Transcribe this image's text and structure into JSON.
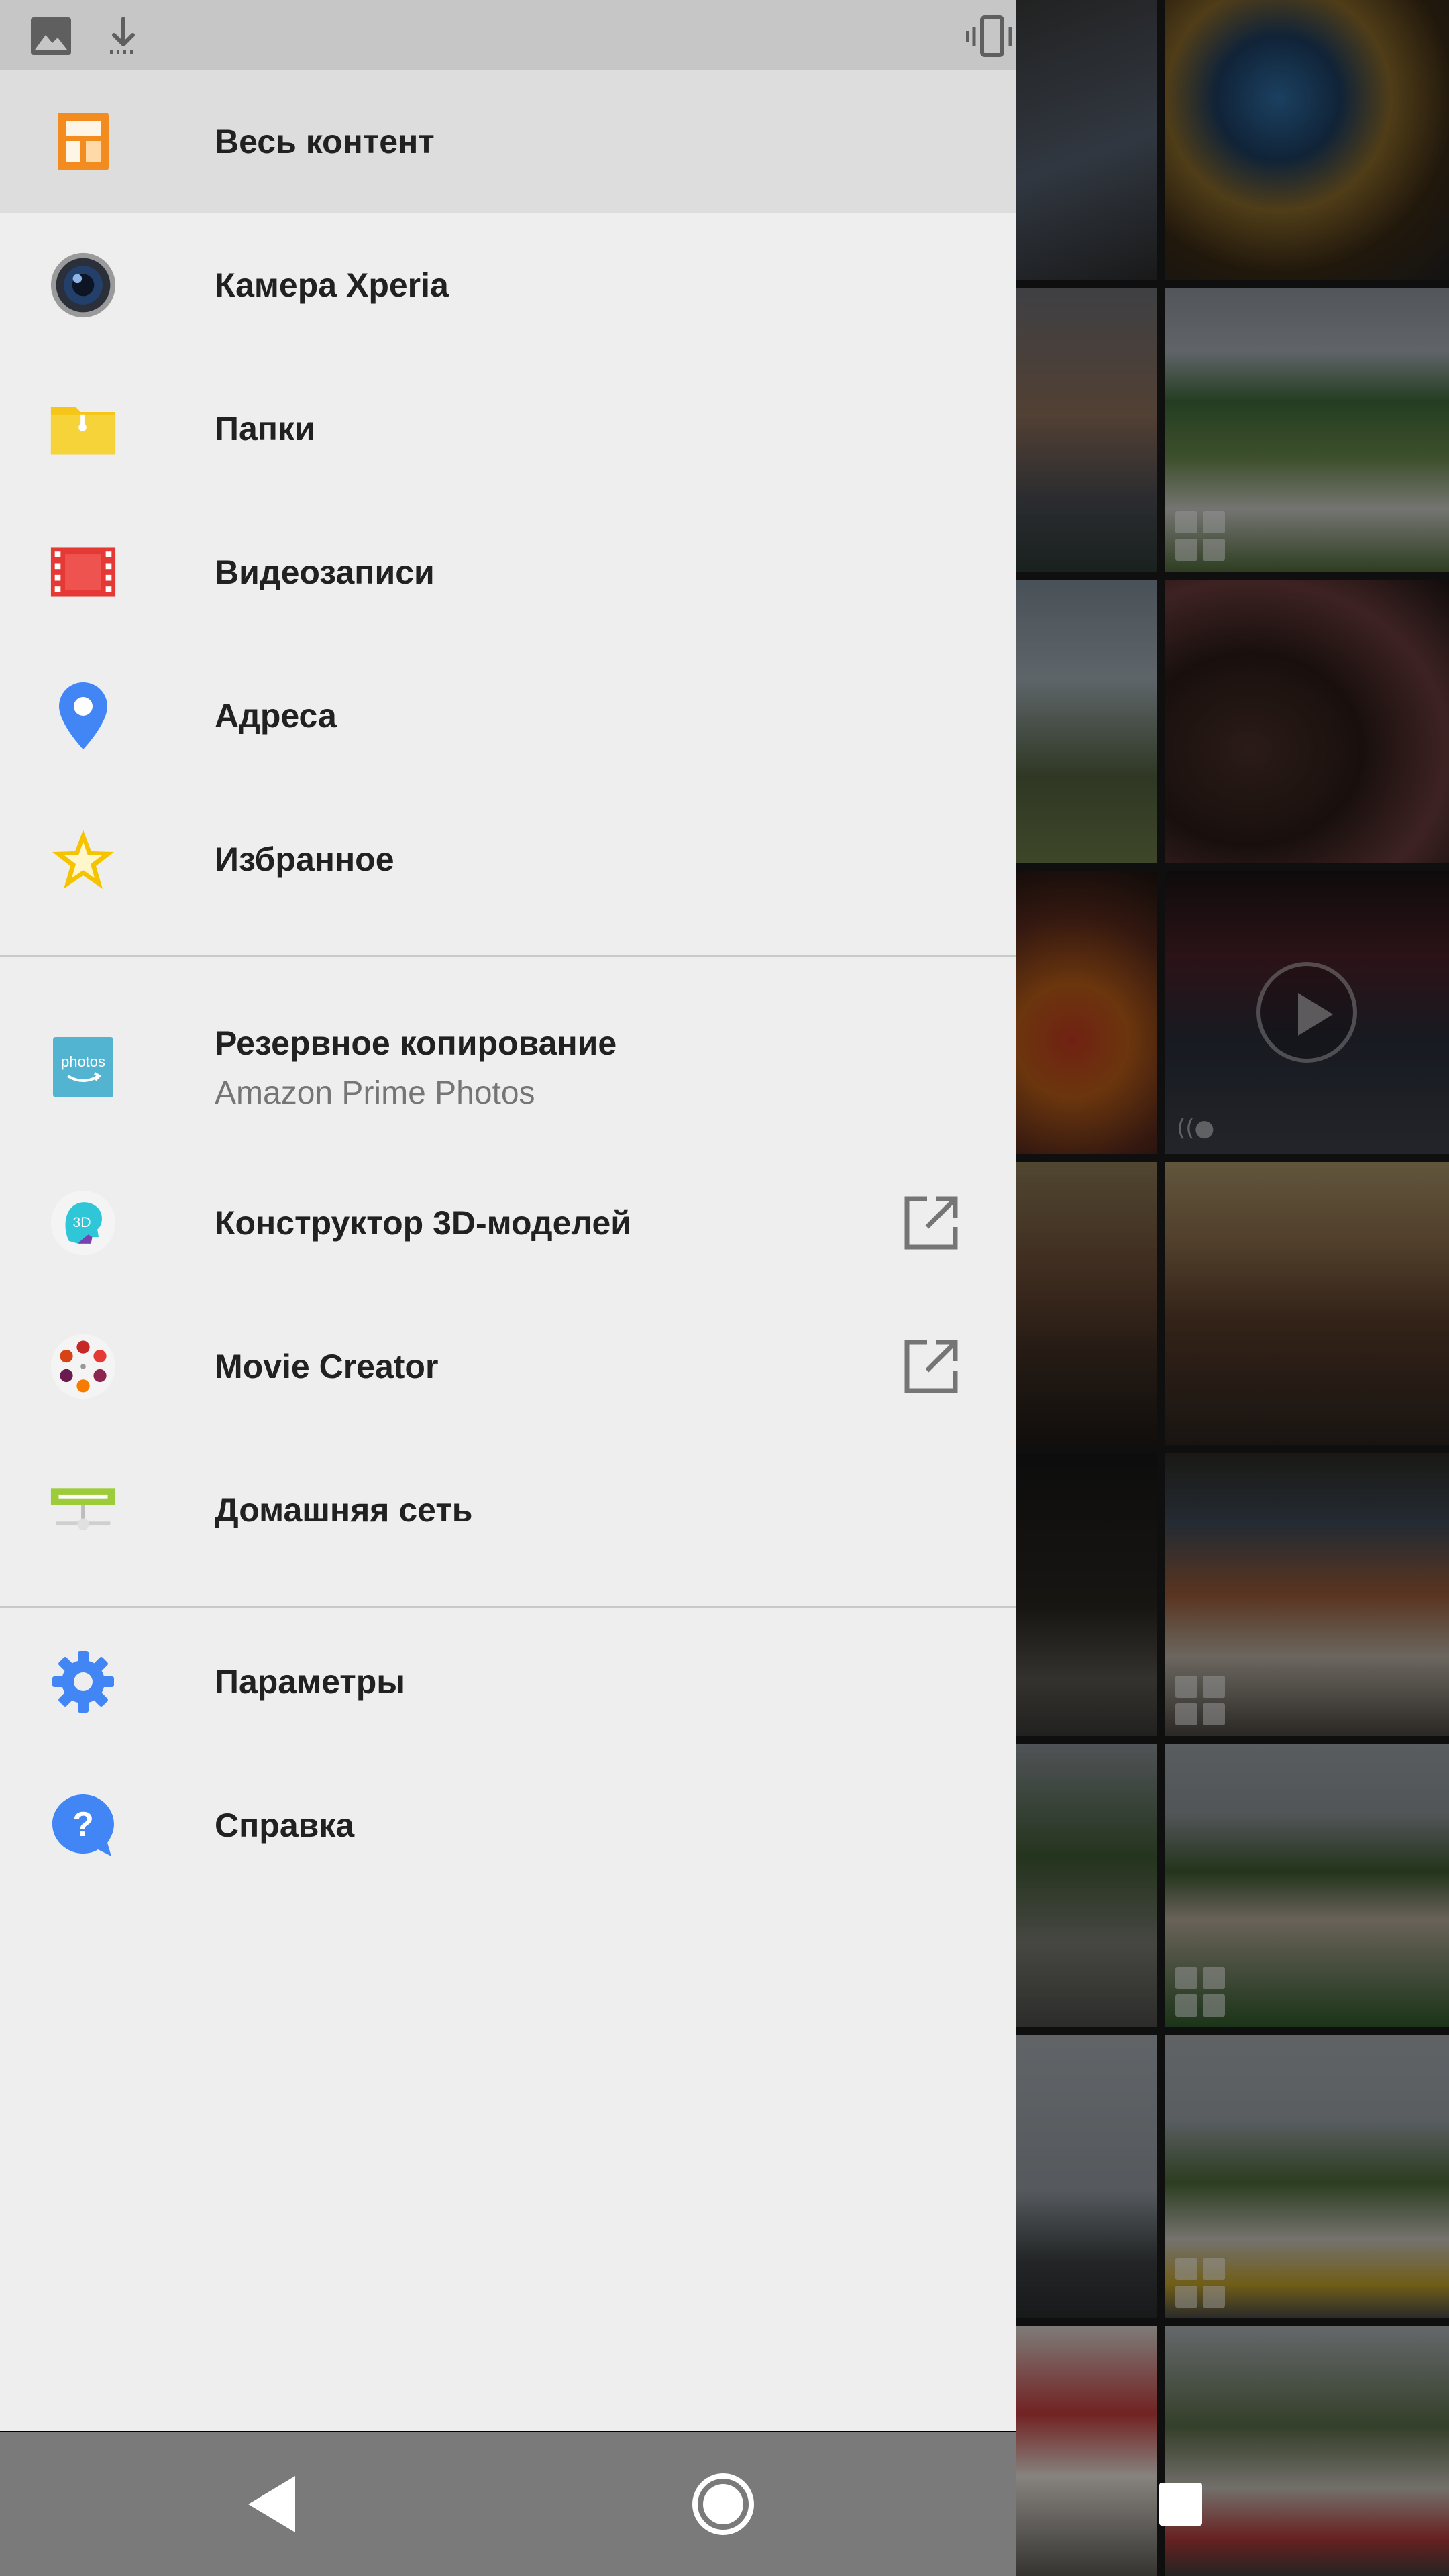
{
  "status_bar": {
    "icons": [
      "image-icon",
      "download-icon",
      "vibrate-icon"
    ]
  },
  "drawer": {
    "items": [
      {
        "label": "Весь контент",
        "icon": "all-content-icon",
        "selected": true,
        "external": false
      },
      {
        "label": "Камера Xperia",
        "icon": "camera-lens-icon",
        "selected": false,
        "external": false
      },
      {
        "label": "Папки",
        "icon": "folder-icon",
        "selected": false,
        "external": false
      },
      {
        "label": "Видеозаписи",
        "icon": "film-icon",
        "selected": false,
        "external": false
      },
      {
        "label": "Адреса",
        "icon": "map-pin-icon",
        "selected": false,
        "external": false
      },
      {
        "label": "Избранное",
        "icon": "star-icon",
        "selected": false,
        "external": false
      }
    ],
    "services": [
      {
        "label": "Резервное копирование",
        "sublabel": "Amazon Prime Photos",
        "icon": "amazon-photos-icon",
        "icon_text": "photos",
        "external": false
      },
      {
        "label": "Конструктор 3D-моделей",
        "icon": "3d-creator-icon",
        "icon_text": "3D",
        "external": true
      },
      {
        "label": "Movie Creator",
        "icon": "movie-creator-icon",
        "external": true
      },
      {
        "label": "Домашняя сеть",
        "icon": "home-network-icon",
        "external": false
      }
    ],
    "settings": [
      {
        "label": "Параметры",
        "icon": "gear-icon"
      },
      {
        "label": "Справка",
        "icon": "help-icon",
        "icon_text": "?"
      }
    ]
  },
  "grid_overlay": {
    "burst_label": "((●"
  },
  "navigation_bar": {
    "buttons": [
      "back-button",
      "home-button",
      "recents-button"
    ]
  },
  "colors": {
    "drawer_bg": "#eeeeee",
    "selected_bg": "#dddddd",
    "status_bar_bg": "#c6c6c6",
    "nav_bar_bg": "#7a7a7a",
    "pin_blue": "#4285f4",
    "folder_yellow": "#f5c518",
    "film_red": "#e53935",
    "content_orange": "#f28c1e"
  }
}
